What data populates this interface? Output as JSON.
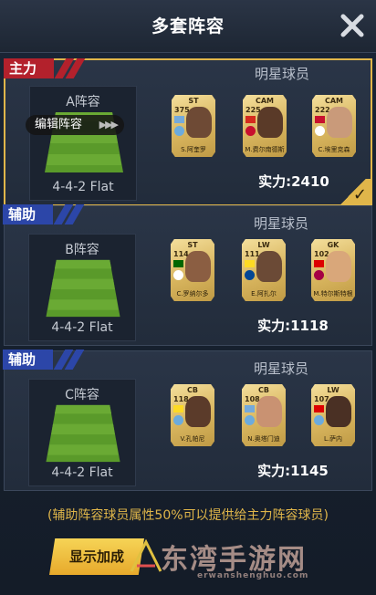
{
  "header": {
    "title": "多套阵容"
  },
  "stars_label": "明星球员",
  "panels": [
    {
      "tag": "主力",
      "lineup_name": "A阵容",
      "formation": "4-4-2 Flat",
      "edit_label": "编辑阵容",
      "strength": "实力:2410",
      "cards": [
        {
          "pos": "ST",
          "rating": "375",
          "name": "S.阿奎罗",
          "flag": "#75aadb",
          "club": "#6cabdd",
          "face": "#6e4a35"
        },
        {
          "pos": "CAM",
          "rating": "225",
          "name": "M.费尔南德斯",
          "flag": "#d52b1e",
          "club": "#c8102e",
          "face": "#5a3a28"
        },
        {
          "pos": "CAM",
          "rating": "222",
          "name": "C.埃里克森",
          "flag": "#c8102e",
          "club": "#ffffff",
          "face": "#c99a7a"
        }
      ]
    },
    {
      "tag": "辅助",
      "lineup_name": "B阵容",
      "formation": "4-4-2 Flat",
      "strength": "实力:1118",
      "cards": [
        {
          "pos": "ST",
          "rating": "114",
          "name": "C.罗纳尔多",
          "flag": "#006600",
          "club": "#ffffff",
          "face": "#8b5e42"
        },
        {
          "pos": "LW",
          "rating": "111",
          "name": "E.阿扎尔",
          "flag": "#fdda24",
          "club": "#034694",
          "face": "#6b4a36"
        },
        {
          "pos": "GK",
          "rating": "102",
          "name": "M.特尔斯特根",
          "flag": "#dd0000",
          "club": "#a50044",
          "face": "#d9a77a"
        }
      ]
    },
    {
      "tag": "辅助",
      "lineup_name": "C阵容",
      "formation": "4-4-2 Flat",
      "strength": "实力:1145",
      "cards": [
        {
          "pos": "CB",
          "rating": "118",
          "name": "V.孔帕尼",
          "flag": "#fdda24",
          "club": "#6cabdd",
          "face": "#5b3b2a"
        },
        {
          "pos": "CB",
          "rating": "108",
          "name": "N.奥塔门迪",
          "flag": "#75aadb",
          "club": "#6cabdd",
          "face": "#c99272"
        },
        {
          "pos": "LW",
          "rating": "107",
          "name": "L.萨内",
          "flag": "#dd0000",
          "club": "#6cabdd",
          "face": "#4a3024"
        }
      ]
    }
  ],
  "note": "(辅助阵容球员属性50%可以提供给主力阵容球员)",
  "buttons": {
    "show_bonus": "显示加成"
  },
  "watermark": {
    "text": "东湾手游网",
    "sub": "erwanshenghuo.com"
  },
  "colors": {
    "accent": "#e0b64a",
    "main_tag": "#b3212c",
    "sub_tag": "#2c46a8"
  }
}
